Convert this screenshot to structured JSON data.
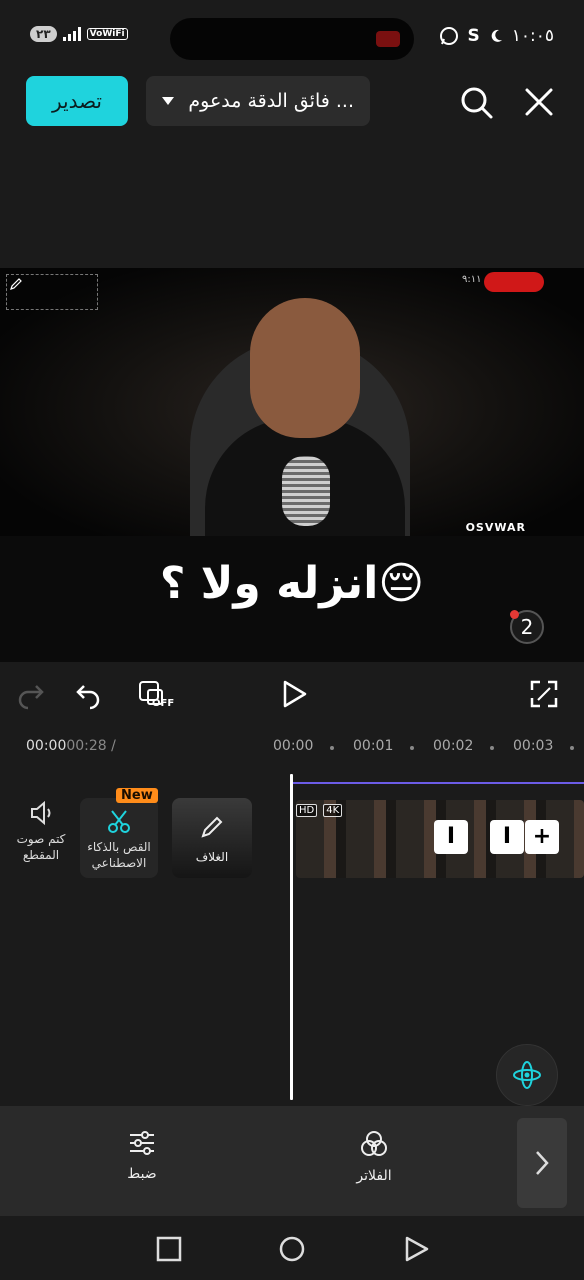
{
  "status_bar": {
    "left_badge": "٢٣",
    "wifi_label": "VoWiFi",
    "time": "١٠:٠٥",
    "icons": [
      "whatsapp-icon",
      "s-icon",
      "moon-icon"
    ]
  },
  "toolbar": {
    "export_label": "تصدير",
    "resolution_label": "فائق الدقة مدعوم ...",
    "icons": [
      "search-icon",
      "close-icon"
    ]
  },
  "preview": {
    "watermark": "OSVWAR",
    "corner_label": "٩:١١"
  },
  "caption": {
    "text": "انزله ولا ؟😔"
  },
  "badge": {
    "count": "2"
  },
  "player": {
    "icons": [
      "redo-icon",
      "undo-icon",
      "keyframe-off-icon",
      "play-icon",
      "fullscreen-icon"
    ],
    "keyframe_label": "OFF"
  },
  "timeline": {
    "current_time": "00:00",
    "total_time": "00:28 /",
    "ticks": [
      "00:00",
      "00:01",
      "00:02",
      "00:03"
    ],
    "tools": {
      "mute": "كتم صوت المقطع",
      "ai_cut": "القص بالذكاء الاصطناعي",
      "ai_badge": "New",
      "cover": "الغلاف"
    },
    "clip_icons": [
      "HD",
      "4K"
    ],
    "add_label": "+"
  },
  "bottom_toolbar": {
    "items": [
      {
        "label": "ضبط",
        "icon": "sliders-icon"
      },
      {
        "label": "الفلاتر",
        "icon": "filters-icon"
      }
    ]
  },
  "colors": {
    "accent": "#1fd3dd",
    "badge_orange": "#ff8c1a",
    "track_purple": "#6c5ce7"
  }
}
